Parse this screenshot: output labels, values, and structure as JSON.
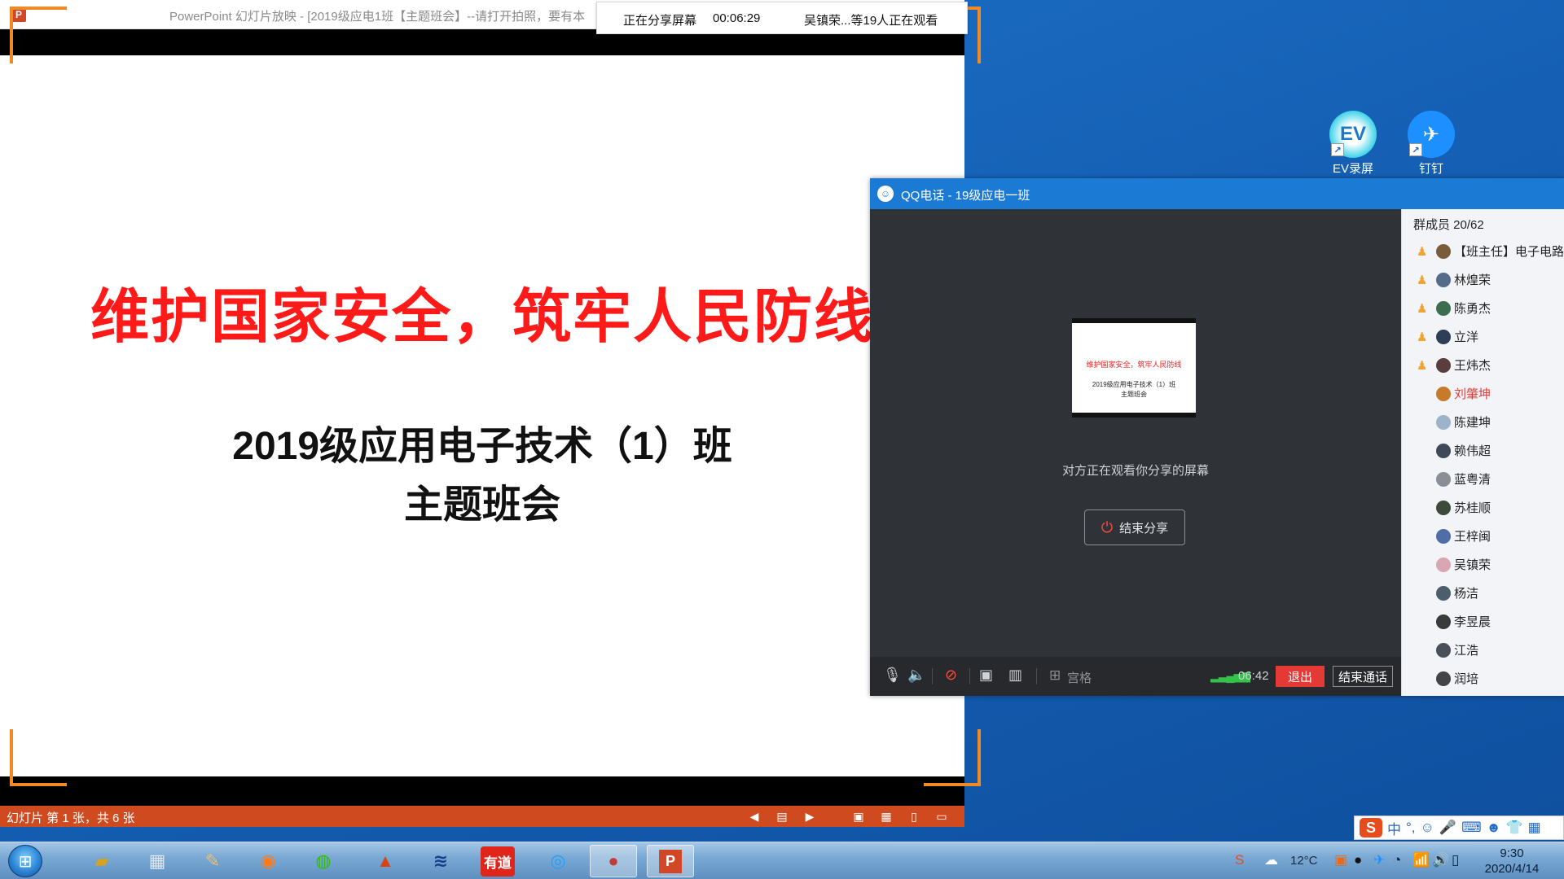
{
  "ppt": {
    "window_title": "PowerPoint 幻灯片放映 - [2019级应电1班【主题班会】--请打开拍照，要有本",
    "slide": {
      "title": "维护国家安全，筑牢人民防线",
      "subtitle_line1": "2019级应用电子技术（1）班",
      "subtitle_line2": "主题班会"
    },
    "status_text": "幻灯片 第 1 张，共 6 张"
  },
  "share_banner": {
    "status": "正在分享屏幕",
    "duration": "00:06:29",
    "viewers": "吴镇荣...等19人正在观看"
  },
  "desktop_icons": [
    {
      "label": "EV录屏",
      "icon": "ev-recorder-icon"
    },
    {
      "label": "钉钉",
      "icon": "dingtalk-icon"
    }
  ],
  "qq_call": {
    "title": "QQ电话 - 19级应电一班",
    "watching_text": "对方正在观看你分享的屏幕",
    "end_share_label": "结束分享",
    "thumbnail": {
      "title": "维护国家安全，筑牢人民防线",
      "subtitle": "2019级应用电子技术（1）班",
      "subtitle2": "主题班会"
    },
    "grid_label": "宫格",
    "call_time": "06:42",
    "exit_label": "退出",
    "end_call_label": "结束通话",
    "members_header": "群成员 20/62",
    "members": [
      {
        "name": "【班主任】电子电路",
        "mic": true
      },
      {
        "name": "林煌荣",
        "mic": true
      },
      {
        "name": "陈勇杰",
        "mic": true
      },
      {
        "name": "立洋",
        "mic": true
      },
      {
        "name": "王炜杰",
        "mic": true
      },
      {
        "name": "刘肇坤",
        "mic": false,
        "speaking": true
      },
      {
        "name": "陈建坤",
        "mic": false
      },
      {
        "name": "赖伟超",
        "mic": false
      },
      {
        "name": "蓝粤清",
        "mic": false
      },
      {
        "name": "苏桂顺",
        "mic": false
      },
      {
        "name": "王梓闽",
        "mic": false
      },
      {
        "name": "吴镇荣",
        "mic": false
      },
      {
        "name": "杨洁",
        "mic": false
      },
      {
        "name": "李昱晨",
        "mic": false
      },
      {
        "name": "江浩",
        "mic": false
      },
      {
        "name": "润培",
        "mic": false
      }
    ]
  },
  "ime": {
    "mode": "中",
    "punct": "°,"
  },
  "taskbar": {
    "temperature": "12°C",
    "time": "9:30",
    "date": "2020/4/14",
    "youdao_label": "有道"
  },
  "colors": {
    "accent_orange": "#f08a24",
    "ppt_status": "#d04a1f",
    "slide_title_red": "#ff1a1a",
    "qq_blue": "#1b7ad4",
    "exit_red": "#e53935"
  }
}
